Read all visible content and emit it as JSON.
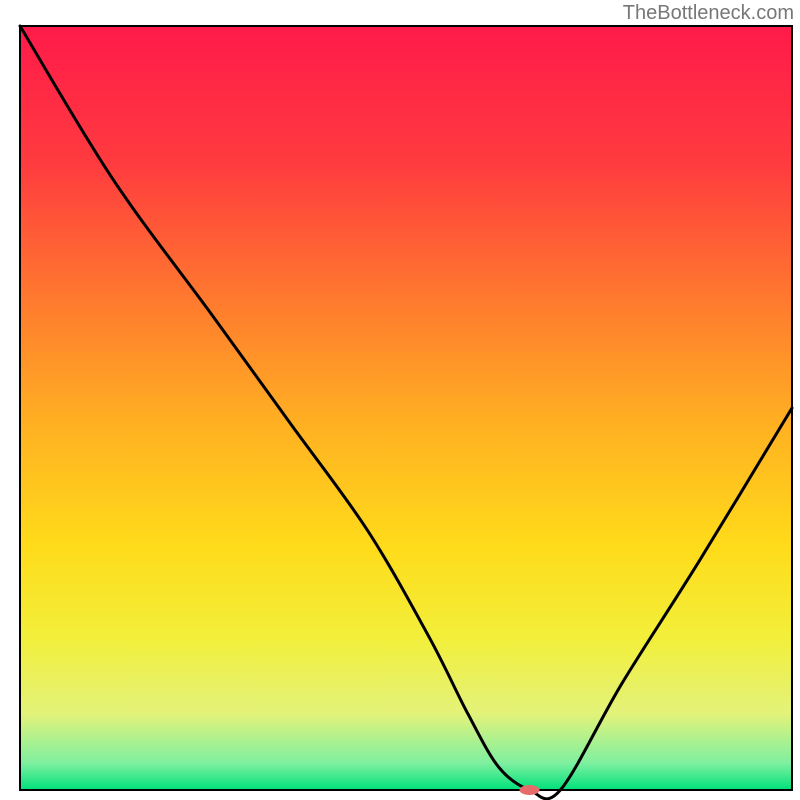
{
  "watermark": "TheBottleneck.com",
  "chart_data": {
    "type": "line",
    "title": "",
    "xlabel": "",
    "ylabel": "",
    "xlim": [
      0,
      100
    ],
    "ylim": [
      0,
      100
    ],
    "grid": false,
    "background_gradient": {
      "top_color": "#ff1a4a",
      "stops": [
        {
          "pos": 0.0,
          "color": "#ff1a4a"
        },
        {
          "pos": 0.18,
          "color": "#ff3b3f"
        },
        {
          "pos": 0.36,
          "color": "#ff7a2e"
        },
        {
          "pos": 0.52,
          "color": "#ffb022"
        },
        {
          "pos": 0.68,
          "color": "#ffdb1a"
        },
        {
          "pos": 0.8,
          "color": "#f2ef3a"
        },
        {
          "pos": 0.9,
          "color": "#e3f27a"
        },
        {
          "pos": 0.965,
          "color": "#7ef0a0"
        },
        {
          "pos": 1.0,
          "color": "#00e07a"
        }
      ]
    },
    "series": [
      {
        "name": "bottleneck-curve",
        "x": [
          0,
          12,
          25,
          35,
          45,
          53,
          58,
          62,
          66,
          70,
          78,
          88,
          100
        ],
        "y": [
          100,
          80,
          62,
          48,
          34,
          20,
          10,
          3,
          0,
          0,
          14,
          30,
          50
        ]
      }
    ],
    "marker": {
      "name": "optimal-point",
      "x": 66,
      "y": 0,
      "color": "#e86b6b",
      "rx": 10,
      "ry": 5
    }
  }
}
